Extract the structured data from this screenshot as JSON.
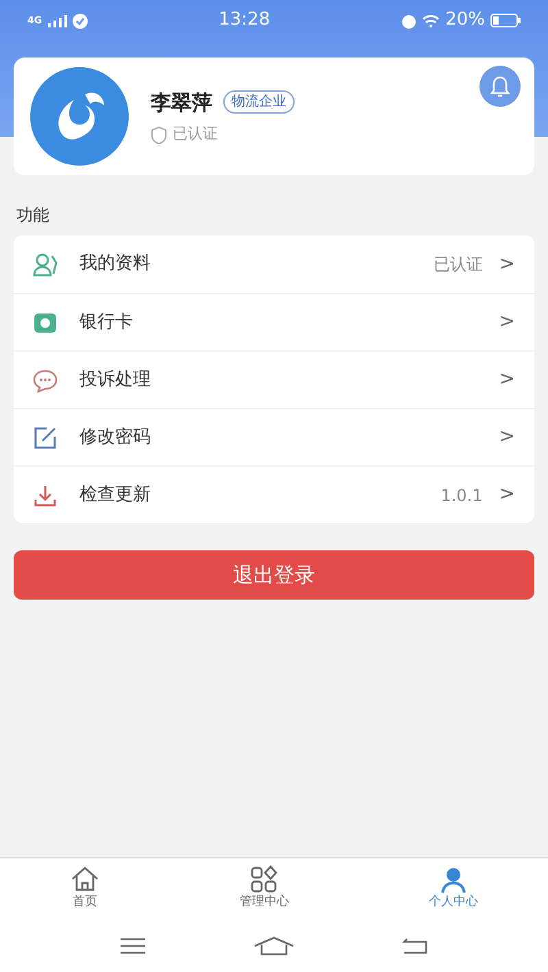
{
  "status_bar": {
    "network": "4G",
    "time": "13:28",
    "battery": "20%"
  },
  "profile": {
    "name": "李翠萍",
    "tag": "物流企业",
    "verified": "已认证"
  },
  "section_title": "功能",
  "menu": [
    {
      "kind": "person",
      "label": "我的资料",
      "value": "已认证",
      "chevron": ">"
    },
    {
      "kind": "card",
      "label": "银行卡",
      "chevron": ">"
    },
    {
      "kind": "chat",
      "label": "投诉处理",
      "chevron": ">"
    },
    {
      "kind": "edit",
      "label": "修改密码",
      "chevron": ">"
    },
    {
      "kind": "download",
      "label": "检查更新",
      "value": "1.0.1",
      "chevron": ">"
    }
  ],
  "logout": "退出登录",
  "tabs": [
    {
      "kind": "home",
      "label": "首页",
      "selected": false
    },
    {
      "kind": "grid",
      "label": "管理中心",
      "selected": false
    },
    {
      "kind": "user",
      "label": "个人中心",
      "selected": true
    }
  ]
}
